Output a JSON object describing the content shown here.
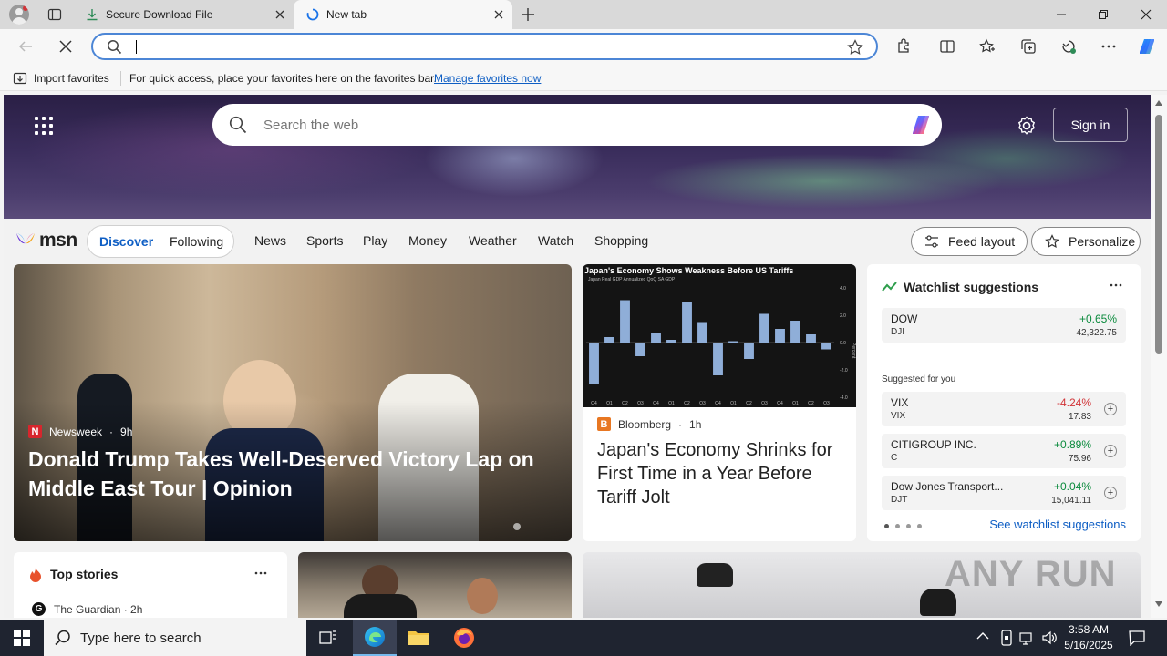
{
  "browser": {
    "tabs": [
      {
        "label": "Secure Download File"
      },
      {
        "label": "New tab"
      }
    ],
    "address_value": "",
    "favorites_bar": {
      "import_label": "Import favorites",
      "message": "For quick access, place your favorites here on the favorites bar.",
      "link": "Manage favorites now"
    }
  },
  "hero": {
    "search_placeholder": "Search the web",
    "signin_label": "Sign in"
  },
  "nav": {
    "logo": "msn",
    "segments": [
      "Discover",
      "Following"
    ],
    "links": [
      "News",
      "Sports",
      "Play",
      "Money",
      "Weather",
      "Watch",
      "Shopping"
    ],
    "feed_layout": "Feed layout",
    "personalize": "Personalize"
  },
  "main_article": {
    "source": "Newsweek",
    "age": "9h",
    "title": "Donald Trump Takes Well-Deserved Victory Lap on Middle East Tour | Opinion"
  },
  "japan_card": {
    "chart_title": "Japan's Economy Shows Weakness Before US Tariffs",
    "chart_subtitle": "Japan Real GDP Annualized QoQ SA GDP",
    "source": "Bloomberg",
    "age": "1h",
    "title": "Japan's Economy Shrinks for First Time in a Year Before Tariff Jolt"
  },
  "chart_data": {
    "type": "bar",
    "title": "Japan's Economy Shows Weakness Before US Tariffs",
    "ylabel": "Percent",
    "ylim": [
      -4,
      4
    ],
    "values": [
      -3.0,
      0.4,
      3.1,
      -1.0,
      0.7,
      0.2,
      3.0,
      1.5,
      -2.4,
      0.1,
      -1.2,
      2.1,
      1.0,
      1.6,
      0.6,
      -0.5
    ],
    "categories": [
      "Q4",
      "Q1",
      "Q2",
      "Q3",
      "Q4",
      "Q1",
      "Q2",
      "Q3",
      "Q4",
      "Q1",
      "Q2",
      "Q3",
      "Q4",
      "Q1",
      "Q2",
      "Q3"
    ]
  },
  "watchlist": {
    "title": "Watchlist suggestions",
    "main": {
      "name": "DOW",
      "symbol": "DJI",
      "change": "+0.65%",
      "value": "42,322.75"
    },
    "suggested_label": "Suggested for you",
    "suggested": [
      {
        "name": "VIX",
        "symbol": "VIX",
        "change": "-4.24%",
        "value": "17.83"
      },
      {
        "name": "CITIGROUP INC.",
        "symbol": "C",
        "change": "+0.89%",
        "value": "75.96"
      },
      {
        "name": "Dow Jones Transport...",
        "symbol": "DJT",
        "change": "+0.04%",
        "value": "15,041.11"
      }
    ],
    "see_all": "See watchlist suggestions"
  },
  "top_stories": {
    "title": "Top stories",
    "source": "The Guardian · 2h"
  },
  "watermark": "ANY RUN",
  "taskbar": {
    "search_placeholder": "Type here to search",
    "time": "3:58 AM",
    "date": "5/16/2025"
  },
  "colors": {
    "accent": "#0e5ec4",
    "up": "#0a8a3c",
    "down": "#d13438"
  }
}
